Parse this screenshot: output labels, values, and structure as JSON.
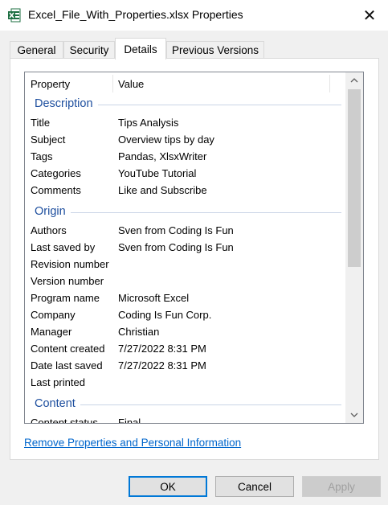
{
  "window": {
    "title": "Excel_File_With_Properties.xlsx Properties",
    "close_glyph": "✕",
    "icon": "excel-file-icon"
  },
  "tabs": [
    {
      "label": "General",
      "active": false
    },
    {
      "label": "Security",
      "active": false
    },
    {
      "label": "Details",
      "active": true
    },
    {
      "label": "Previous Versions",
      "active": false
    }
  ],
  "list": {
    "header": {
      "property": "Property",
      "value": "Value"
    },
    "groups": [
      {
        "label": "Description"
      },
      {
        "label": "Origin"
      },
      {
        "label": "Content"
      }
    ],
    "description_rows": [
      {
        "property": "Title",
        "value": "Tips Analysis"
      },
      {
        "property": "Subject",
        "value": "Overview tips by day"
      },
      {
        "property": "Tags",
        "value": "Pandas, XlsxWriter"
      },
      {
        "property": "Categories",
        "value": "YouTube Tutorial"
      },
      {
        "property": "Comments",
        "value": "Like and Subscribe"
      }
    ],
    "origin_rows": [
      {
        "property": "Authors",
        "value": "Sven from Coding Is Fun"
      },
      {
        "property": "Last saved by",
        "value": "Sven from Coding Is Fun"
      },
      {
        "property": "Revision number",
        "value": ""
      },
      {
        "property": "Version number",
        "value": ""
      },
      {
        "property": "Program name",
        "value": "Microsoft Excel"
      },
      {
        "property": "Company",
        "value": "Coding Is Fun Corp."
      },
      {
        "property": "Manager",
        "value": "Christian"
      },
      {
        "property": "Content created",
        "value": "7/27/2022 8:31 PM"
      },
      {
        "property": "Date last saved",
        "value": "7/27/2022 8:31 PM"
      },
      {
        "property": "Last printed",
        "value": ""
      }
    ],
    "content_rows": [
      {
        "property": "Content status",
        "value": "Final"
      }
    ]
  },
  "link_text": "Remove Properties and Personal Information",
  "buttons": {
    "ok": "OK",
    "cancel": "Cancel",
    "apply": "Apply"
  },
  "colors": {
    "accent": "#0078d7",
    "group_text": "#1d4e9e",
    "link": "#0066cc"
  }
}
